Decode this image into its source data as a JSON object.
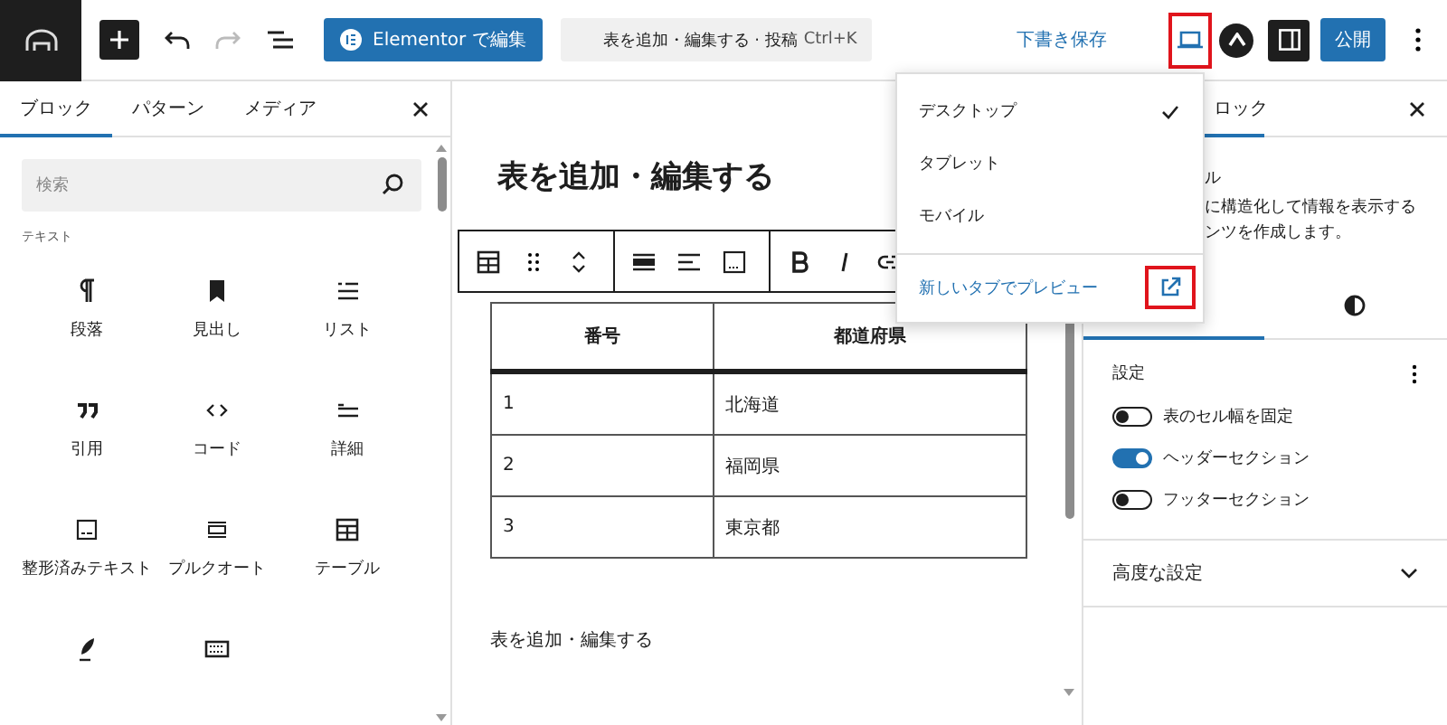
{
  "topbar": {
    "undo": {
      "disabled": false
    },
    "redo": {
      "disabled": true
    },
    "elementor_button": "Elementor で編集",
    "command_bar": {
      "title": "表を追加・編集する · 投稿",
      "shortcut": "Ctrl+K"
    },
    "save_draft": "下書き保存",
    "preview_button": {
      "highlighted": true
    },
    "settings_toggle": {
      "pressed": true
    },
    "publish": "公開"
  },
  "left_panel": {
    "tabs": [
      {
        "label": "ブロック",
        "selected": true
      },
      {
        "label": "パターン",
        "selected": false
      },
      {
        "label": "メディア",
        "selected": false
      }
    ],
    "search": {
      "placeholder": "検索"
    },
    "category": "テキスト",
    "blocks": [
      {
        "kind": "paragraph",
        "label": "段落"
      },
      {
        "kind": "heading",
        "label": "見出し"
      },
      {
        "kind": "list",
        "label": "リスト"
      },
      {
        "kind": "quote",
        "label": "引用"
      },
      {
        "kind": "code",
        "label": "コード"
      },
      {
        "kind": "details",
        "label": "詳細"
      },
      {
        "kind": "preformatted",
        "label": "整形済みテキスト"
      },
      {
        "kind": "pullquote",
        "label": "プルクオート"
      },
      {
        "kind": "table",
        "label": "テーブル"
      },
      {
        "kind": "verse"
      },
      {
        "kind": "keyboard"
      }
    ]
  },
  "canvas": {
    "title": "表を追加・編集する",
    "table": {
      "columns": [
        "番号",
        "都道府県"
      ],
      "rows": [
        [
          "1",
          "北海道"
        ],
        [
          "2",
          "福岡県"
        ],
        [
          "3",
          "東京都"
        ]
      ]
    },
    "paragraph": "表を追加・編集する"
  },
  "preview_menu": {
    "items": [
      {
        "label": "デスクトップ",
        "selected": true
      },
      {
        "label": "タブレット",
        "selected": false
      },
      {
        "label": "モバイル",
        "selected": false
      }
    ],
    "link": "新しいタブでプレビュー",
    "link_icon_highlighted": true
  },
  "right_panel": {
    "tab": "ロック",
    "description": [
      "ル",
      "に構造化して情報を表示する",
      "ンツを作成します。"
    ],
    "inspector_tabs": [
      {
        "selected": true
      },
      {
        "selected": false
      }
    ],
    "settings": {
      "title": "設定",
      "toggles": [
        {
          "label": "表のセル幅を固定",
          "on": false
        },
        {
          "label": "ヘッダーセクション",
          "on": true
        },
        {
          "label": "フッターセクション",
          "on": false
        }
      ]
    },
    "advanced": {
      "label": "高度な設定",
      "expanded": false
    }
  }
}
